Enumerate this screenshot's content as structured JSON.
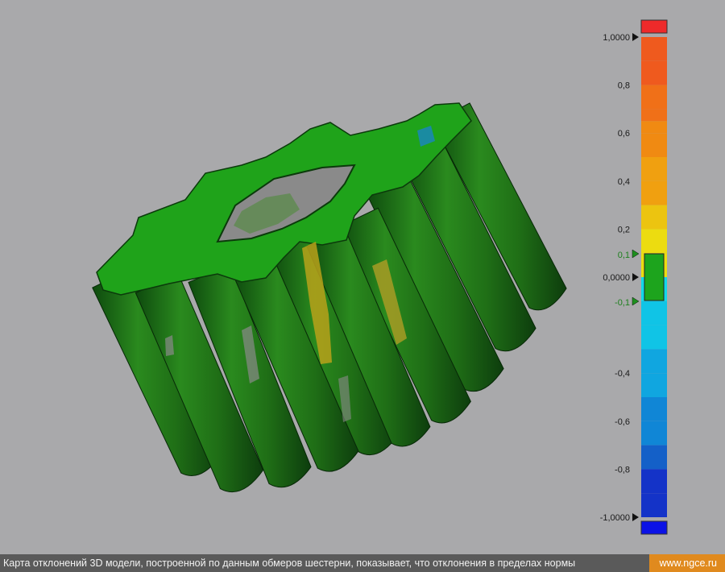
{
  "viewport": {
    "model_name": "gear-deviation-map"
  },
  "color_scale": {
    "max_label": "1,0000",
    "min_label": "-1,0000",
    "zero_label": "0,0000",
    "upper_tolerance_label": "0,1",
    "lower_tolerance_label": "-0,1",
    "tick_labels": [
      {
        "value": 0.8,
        "label": "0,8"
      },
      {
        "value": 0.6,
        "label": "0,6"
      },
      {
        "value": 0.4,
        "label": "0,4"
      },
      {
        "value": 0.2,
        "label": "0,2"
      },
      {
        "value": -0.4,
        "label": "-0,4"
      },
      {
        "value": -0.6,
        "label": "-0,6"
      },
      {
        "value": -0.8,
        "label": "-0,8"
      }
    ],
    "colors": {
      "over": "#ee2a2a",
      "under": "#0b12e6",
      "tolerance": "#1da41d",
      "max": "#ef4a1e",
      "mid_high": "#f0a010",
      "yellow": "#ecdc10",
      "cyan": "#12d8ea",
      "min": "#1433c8"
    }
  },
  "caption": {
    "text": "Карта отклонений 3D модели, построенной по данным обмеров шестерни, показывает, что отклонения в пределах нормы",
    "site": "www.ngce.ru"
  },
  "chart_data": {
    "type": "heatmap",
    "scale_range": [
      -1.0,
      1.0
    ],
    "tolerance": [
      -0.1,
      0.1
    ],
    "ticks": [
      1.0,
      0.8,
      0.6,
      0.4,
      0.2,
      0.1,
      0.0,
      -0.1,
      -0.4,
      -0.6,
      -0.8,
      -1.0
    ]
  }
}
